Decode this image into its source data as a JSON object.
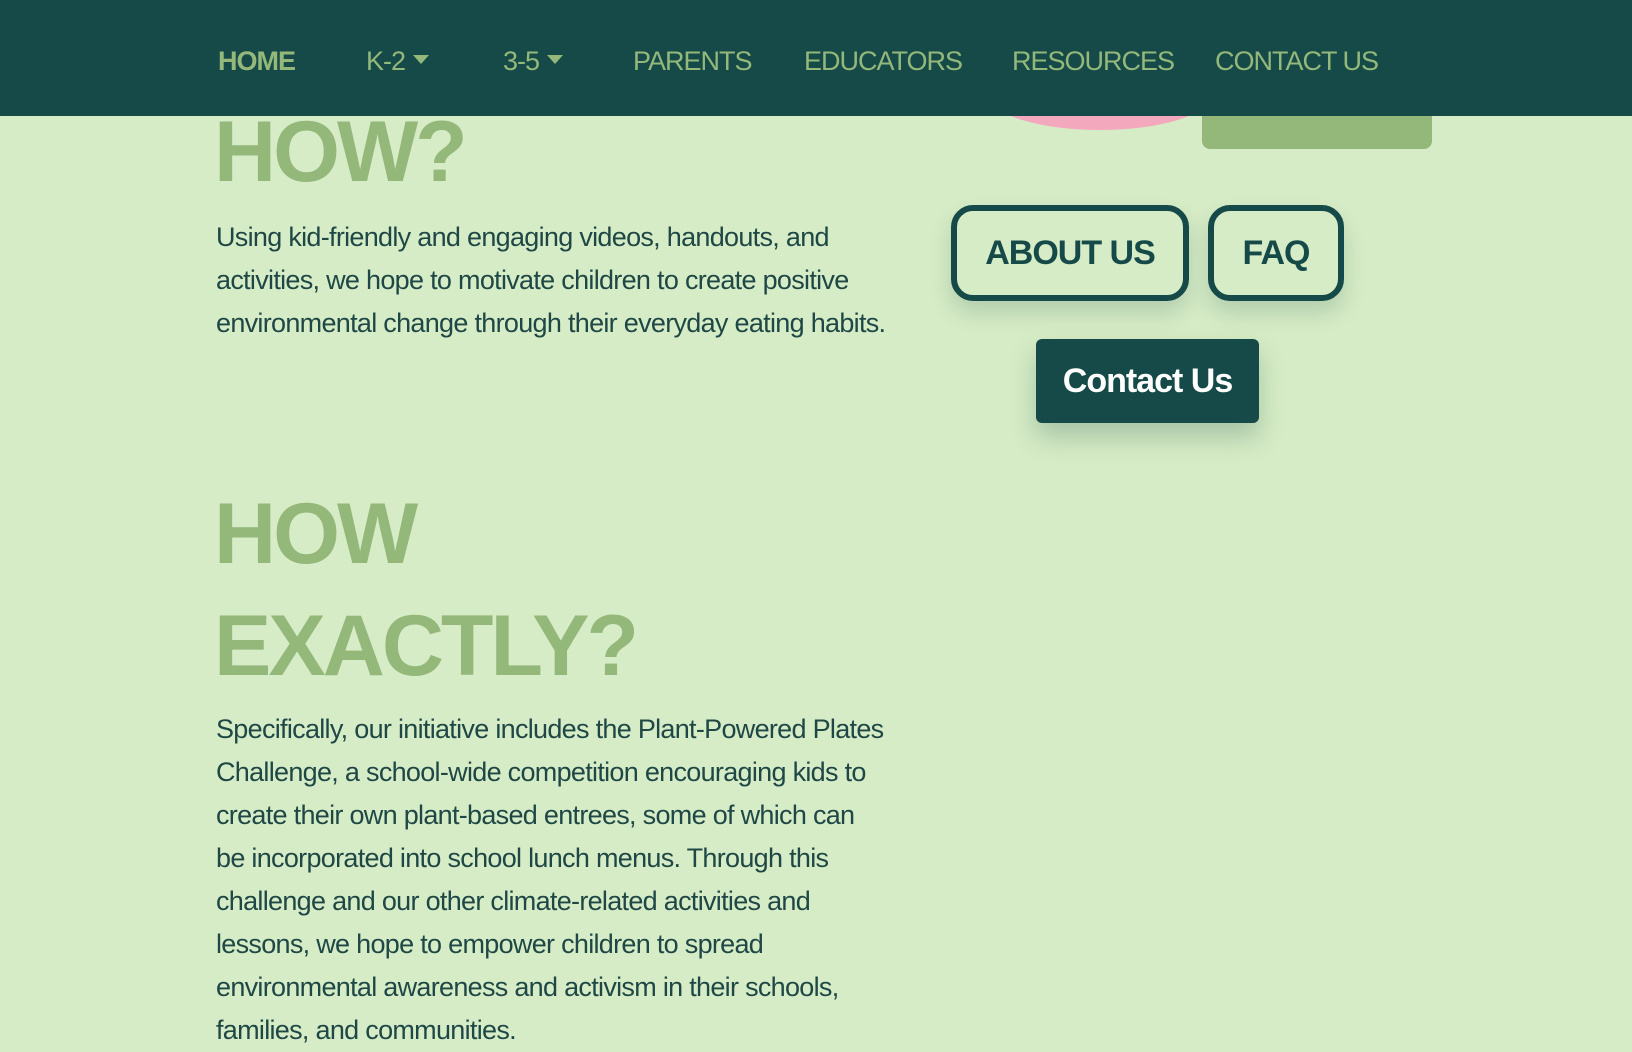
{
  "nav": {
    "items": [
      {
        "label": "HOME",
        "active": true,
        "dropdown": false
      },
      {
        "label": "K-2",
        "active": false,
        "dropdown": true
      },
      {
        "label": "3-5",
        "active": false,
        "dropdown": true
      },
      {
        "label": "PARENTS",
        "active": false,
        "dropdown": false
      },
      {
        "label": "EDUCATORS",
        "active": false,
        "dropdown": false
      },
      {
        "label": "RESOURCES",
        "active": false,
        "dropdown": false
      },
      {
        "label": "CONTACT US",
        "active": false,
        "dropdown": false
      }
    ]
  },
  "sections": {
    "how": {
      "heading": "HOW?",
      "body": "Using kid-friendly and engaging videos, handouts, and activities, we hope to motivate children to create positive environmental change through their everyday eating habits."
    },
    "how_exactly": {
      "heading_line1": "HOW",
      "heading_line2": "EXACTLY?",
      "body": "Specifically, our initiative includes the Plant-Powered Plates Challenge, a school-wide competition encouraging kids to create their own plant-based entrees, some of which can be incorporated into school lunch menus. Through this challenge and our other climate-related activities and lessons, we hope to empower children to spread environmental awareness and activism in their schools, families, and communities."
    }
  },
  "buttons": {
    "about_label": "ABOUT US",
    "faq_label": "FAQ",
    "contact_label": "Contact Us"
  },
  "colors": {
    "nav_bg": "#164a48",
    "page_bg": "#d6ecc6",
    "accent_green": "#93b87a",
    "text_dark": "#1e4745",
    "deco_pink": "#f4a8bd"
  }
}
